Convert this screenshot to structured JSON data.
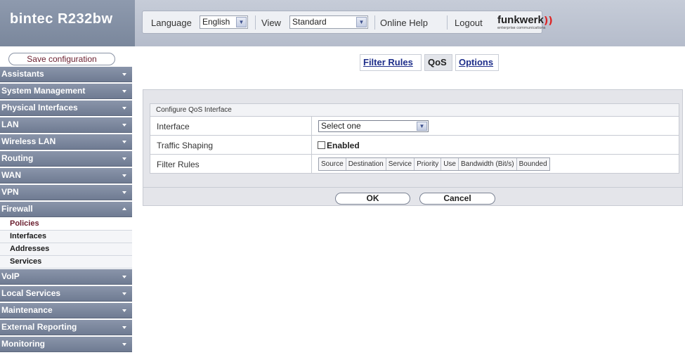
{
  "header": {
    "brand": "bintec R232bw",
    "language_label": "Language",
    "language_value": "English",
    "view_label": "View",
    "view_value": "Standard",
    "online_help": "Online Help",
    "logout": "Logout",
    "logo_word": "funkwerk",
    "logo_tagline": "enterprise communications"
  },
  "sidebar": {
    "save_label": "Save configuration",
    "items": [
      {
        "label": "Assistants"
      },
      {
        "label": "System Management"
      },
      {
        "label": "Physical Interfaces"
      },
      {
        "label": "LAN"
      },
      {
        "label": "Wireless LAN"
      },
      {
        "label": "Routing"
      },
      {
        "label": "WAN"
      },
      {
        "label": "VPN"
      },
      {
        "label": "Firewall"
      },
      {
        "label": "VoIP"
      },
      {
        "label": "Local Services"
      },
      {
        "label": "Maintenance"
      },
      {
        "label": "External Reporting"
      },
      {
        "label": "Monitoring"
      }
    ],
    "firewall_sub": [
      {
        "label": "Policies"
      },
      {
        "label": "Interfaces"
      },
      {
        "label": "Addresses"
      },
      {
        "label": "Services"
      }
    ]
  },
  "tabs": [
    {
      "label": "Filter Rules"
    },
    {
      "label": "QoS"
    },
    {
      "label": "Options"
    }
  ],
  "form": {
    "section_title": "Configure QoS Interface",
    "interface_label": "Interface",
    "interface_value": "Select one",
    "traffic_shaping_label": "Traffic Shaping",
    "traffic_shaping_option": "Enabled",
    "filter_rules_label": "Filter Rules",
    "filter_columns": [
      "Source",
      "Destination",
      "Service",
      "Priority",
      "Use",
      "Bandwidth (Bit/s)",
      "Bounded"
    ]
  },
  "buttons": {
    "ok": "OK",
    "cancel": "Cancel"
  },
  "colors": {
    "menu_bg": "#7a869c",
    "link": "#1e2e8a",
    "active_sub": "#6a1e2e",
    "logo_accent": "#dd2222"
  }
}
